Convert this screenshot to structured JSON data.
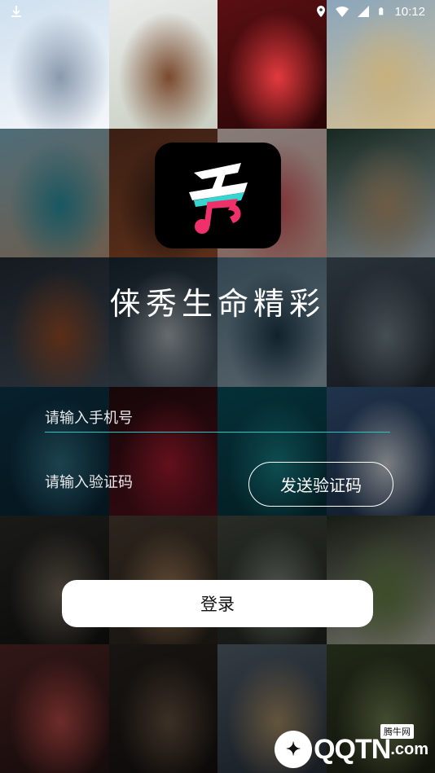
{
  "status_bar": {
    "time": "10:12",
    "icons": [
      "download-icon",
      "location-icon",
      "wifi-icon",
      "signal-icon",
      "battery-icon"
    ]
  },
  "tiles": [
    {
      "name": "tile-ski",
      "colors": [
        "#cfe0ef",
        "#8a9aae",
        "#f4f7fa"
      ]
    },
    {
      "name": "tile-food-lamb",
      "colors": [
        "#e9ebea",
        "#7a4a2e",
        "#c8cfc2"
      ]
    },
    {
      "name": "tile-concert",
      "colors": [
        "#5a0f12",
        "#e23a3e",
        "#2a0607"
      ]
    },
    {
      "name": "tile-backflip",
      "colors": [
        "#8aa6bc",
        "#c7b07d",
        "#d8c090"
      ]
    },
    {
      "name": "tile-coast",
      "colors": [
        "#8fc7db",
        "#2c9fb2",
        "#c9a98c"
      ]
    },
    {
      "name": "tile-canyon",
      "colors": [
        "#6d3a25",
        "#2c1a12",
        "#a6562f"
      ]
    },
    {
      "name": "tile-watermelon",
      "colors": [
        "#f6e2dd",
        "#e55c63",
        "#f0b5a6"
      ]
    },
    {
      "name": "tile-boat",
      "colors": [
        "#2a4b3d",
        "#c7a77b",
        "#d5e3ea"
      ]
    },
    {
      "name": "tile-fox",
      "colors": [
        "#27313b",
        "#a5532b",
        "#4c5966"
      ]
    },
    {
      "name": "tile-van",
      "colors": [
        "#1c2d3a",
        "#b9c3c9",
        "#556472"
      ]
    },
    {
      "name": "tile-pool",
      "colors": [
        "#5d7f94",
        "#1f3e53",
        "#9fb6c2"
      ]
    },
    {
      "name": "tile-bird-man",
      "colors": [
        "#4c5c6a",
        "#7e8f98",
        "#283038"
      ]
    },
    {
      "name": "tile-island",
      "colors": [
        "#0f3c52",
        "#337a8f",
        "#0a2737"
      ]
    },
    {
      "name": "tile-pomegranate",
      "colors": [
        "#2b0d11",
        "#b51e33",
        "#5d1320"
      ]
    },
    {
      "name": "tile-diver",
      "colors": [
        "#0a5866",
        "#1a8c94",
        "#06343d"
      ]
    },
    {
      "name": "tile-mountain",
      "colors": [
        "#3d5f8a",
        "#e2e8ef",
        "#1c3250"
      ]
    },
    {
      "name": "tile-cat",
      "colors": [
        "#30302c",
        "#7c7060",
        "#141412"
      ]
    },
    {
      "name": "tile-market",
      "colors": [
        "#524436",
        "#b08760",
        "#2b241d"
      ]
    },
    {
      "name": "tile-waterfall",
      "colors": [
        "#4a5246",
        "#90998d",
        "#222720"
      ]
    },
    {
      "name": "tile-salad",
      "colors": [
        "#2a3326",
        "#6e8c4a",
        "#c9c9b8"
      ]
    },
    {
      "name": "tile-girl-red",
      "colors": [
        "#5a2b2a",
        "#c7504b",
        "#2a1515"
      ]
    },
    {
      "name": "tile-coffee",
      "colors": [
        "#2d2621",
        "#6e5846",
        "#171310"
      ]
    },
    {
      "name": "tile-giraffe",
      "colors": [
        "#5e6d7c",
        "#b59b6f",
        "#2a3440"
      ]
    },
    {
      "name": "tile-hiker",
      "colors": [
        "#3c4a2c",
        "#7b8a58",
        "#1e2414"
      ]
    }
  ],
  "logo": {
    "name": "app-logo",
    "accent_teal": "#35d6cf",
    "accent_pink": "#f0306a"
  },
  "slogan": "俫秀生命精彩",
  "form": {
    "phone_placeholder": "请输入手机号",
    "code_placeholder": "请输入验证码",
    "send_code_label": "发送验证码",
    "login_label": "登录",
    "accent_line": "#27c6c9"
  },
  "watermark": {
    "tag": "腾牛网",
    "text": "QQTN",
    "suffix": ".com"
  }
}
